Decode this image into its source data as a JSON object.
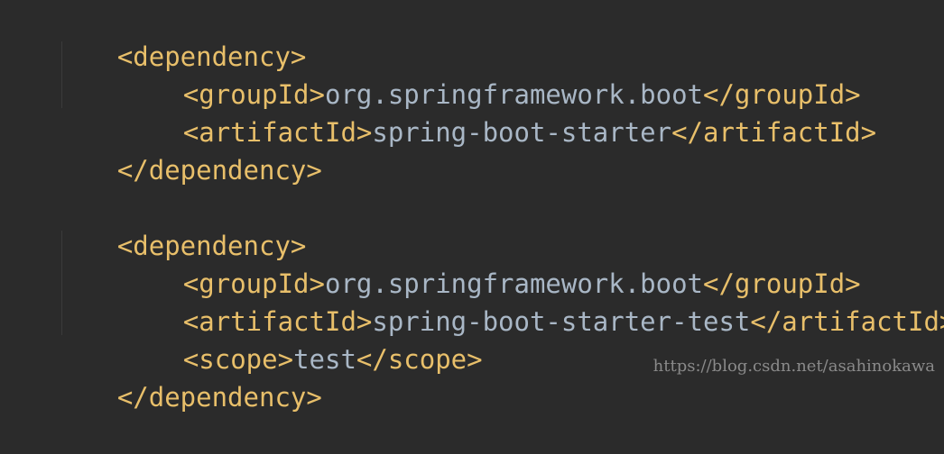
{
  "code": {
    "block1": {
      "open": "<dependency>",
      "groupId_open": "<groupId>",
      "groupId_value": "org.springframework.boot",
      "groupId_close": "</groupId>",
      "artifactId_open": "<artifactId>",
      "artifactId_value": "spring-boot-starter",
      "artifactId_close": "</artifactId>",
      "close": "</dependency>"
    },
    "block2": {
      "open": "<dependency>",
      "groupId_open": "<groupId>",
      "groupId_value": "org.springframework.boot",
      "groupId_close": "</groupId>",
      "artifactId_open": "<artifactId>",
      "artifactId_value": "spring-boot-starter-test",
      "artifactId_close": "</artifactId>",
      "scope_open": "<scope>",
      "scope_value": "test",
      "scope_close": "</scope>",
      "close": "</dependency>"
    }
  },
  "watermark": "https://blog.csdn.net/asahinokawa",
  "colors": {
    "background": "#2b2b2b",
    "tag": "#e8bf6a",
    "text": "#a9b7c6",
    "watermark": "#8a8a8a"
  }
}
